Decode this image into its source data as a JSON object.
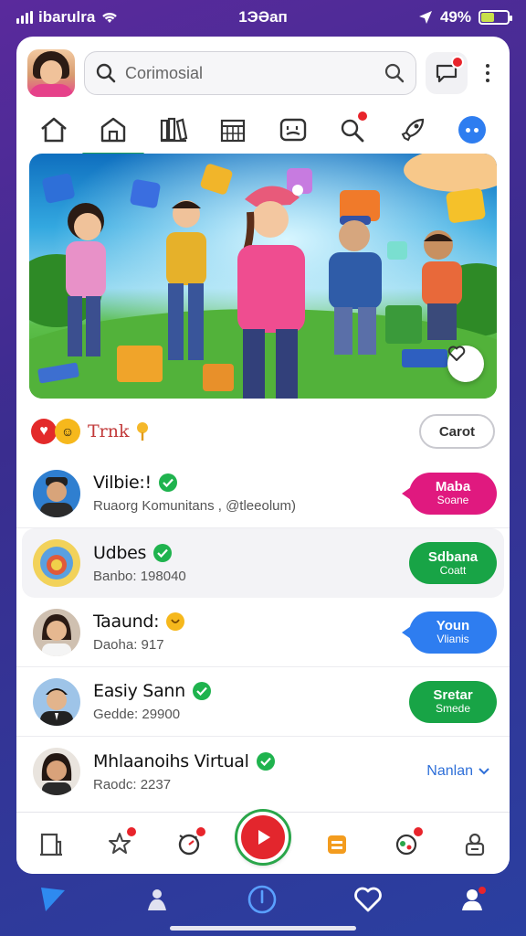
{
  "status_bar": {
    "carrier": "ibarulra",
    "time": "1ЭƏап",
    "battery": "49%",
    "battery_level": 0.49,
    "icons": [
      "signal-icon",
      "wifi-icon",
      "location-icon",
      "battery-icon"
    ]
  },
  "header": {
    "search_placeholder": "Corimosial",
    "chat_badge": true,
    "icons": [
      "avatar",
      "search-icon",
      "chat-icon",
      "more-icon"
    ]
  },
  "nav_tabs": [
    {
      "name": "home",
      "icon": "home-icon",
      "active": false
    },
    {
      "name": "store",
      "icon": "house-icon",
      "active": true
    },
    {
      "name": "library",
      "icon": "books-icon",
      "active": false
    },
    {
      "name": "calendar",
      "icon": "calendar-icon",
      "active": false
    },
    {
      "name": "games",
      "icon": "game-icon",
      "active": false
    },
    {
      "name": "search",
      "icon": "magnifier-icon",
      "active": false,
      "badge": true
    },
    {
      "name": "explore",
      "icon": "rocket-icon",
      "active": false
    },
    {
      "name": "more",
      "icon": "more-circle-icon",
      "active": false
    }
  ],
  "section": {
    "title": "Trnk",
    "action_label": "Carot"
  },
  "rows": [
    {
      "name": "Vilbie:!",
      "sub": "Ruaorg Komunitans , @tleeolum)",
      "pill": {
        "line1": "Maba",
        "line2": "Soane",
        "color": "#e0197f"
      },
      "badge": "check"
    },
    {
      "name": "Udbes",
      "sub": "Banbo: 198040",
      "pill": {
        "line1": "Sdbana",
        "line2": "Coatt",
        "color": "#18a446"
      },
      "badge": "check"
    },
    {
      "name": "Taaund:",
      "sub": "Daoha: 917",
      "pill": {
        "line1": "Youn",
        "line2": "Vlianis",
        "color": "#2e7df0"
      },
      "badge": "emoji"
    },
    {
      "name": "Easiy Sann",
      "sub": "Gedde: 29900",
      "pill": {
        "line1": "Sretar",
        "line2": "Smede",
        "color": "#18a446"
      },
      "badge": "check"
    },
    {
      "name": "Mhlaanoihs Virtual",
      "sub": "Raodc: 2237",
      "link": "Nanlan",
      "badge": "check"
    }
  ],
  "bottom_nav": [
    "building-icon",
    "star-icon",
    "clock-icon",
    "play-icon",
    "gift-icon",
    "globe-icon",
    "lock-icon"
  ],
  "system_nav": [
    "send-icon",
    "person-icon",
    "power-icon",
    "heart-icon",
    "profile-icon"
  ]
}
